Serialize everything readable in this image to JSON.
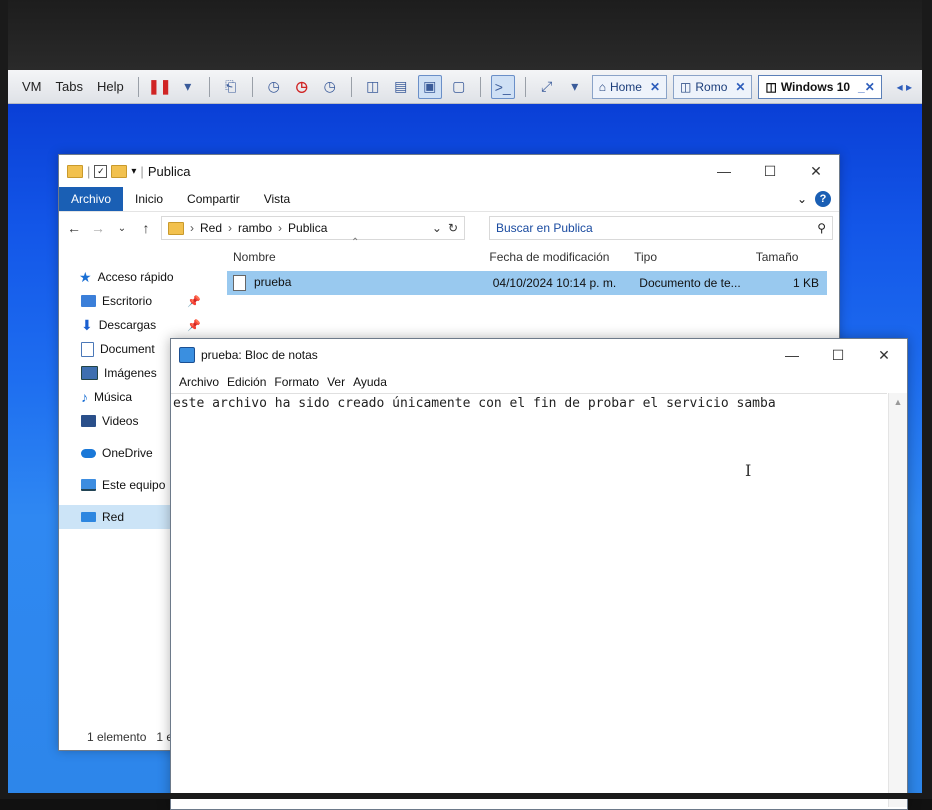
{
  "vm_toolbar": {
    "menus": [
      "VM",
      "Tabs",
      "Help"
    ],
    "tabs": [
      {
        "label": "Home",
        "close": "✕"
      },
      {
        "label": "Romo",
        "close": "✕"
      },
      {
        "label": "Windows 10",
        "close": "_✕"
      }
    ],
    "nav_arrows": "◂ ▸"
  },
  "explorer": {
    "title": "Publica",
    "ribbon_tabs": [
      "Archivo",
      "Inicio",
      "Compartir",
      "Vista"
    ],
    "breadcrumb": [
      "Red",
      "rambo",
      "Publica"
    ],
    "search_placeholder": "Buscar en Publica",
    "columns": {
      "name": "Nombre",
      "date": "Fecha de modificación",
      "type": "Tipo",
      "size": "Tamaño"
    },
    "files": [
      {
        "name": "prueba",
        "date": "04/10/2024 10:14 p. m.",
        "type": "Documento de te...",
        "size": "1 KB"
      }
    ],
    "sidebar": {
      "quick_access": "Acceso rápido",
      "items": [
        "Escritorio",
        "Descargas",
        "Document",
        "Imágenes",
        "Música",
        "Videos"
      ],
      "onedrive": "OneDrive",
      "this_pc": "Este equipo",
      "network": "Red"
    },
    "status": {
      "count": "1 elemento",
      "selected": "1 e"
    }
  },
  "notepad": {
    "title": "prueba: Bloc de notas",
    "menus": [
      "Archivo",
      "Edición",
      "Formato",
      "Ver",
      "Ayuda"
    ],
    "content": "este archivo ha sido creado únicamente con el fin de probar el servicio samba"
  },
  "icons": [
    "pause-icon",
    "snapshot-icon",
    "revert-icon",
    "manager-icon",
    "fullscreen-icon",
    "unity-icon",
    "console-icon",
    "stretch-icon",
    "home-icon",
    "vm-icon",
    "folder-icon",
    "search-icon",
    "help-icon",
    "pin-icon",
    "notepad-icon",
    "text-cursor-icon"
  ],
  "colors": {
    "desktop": "#1e6ef0",
    "selection": "#99c9ef",
    "ribbon_file": "#1a5fb4"
  }
}
